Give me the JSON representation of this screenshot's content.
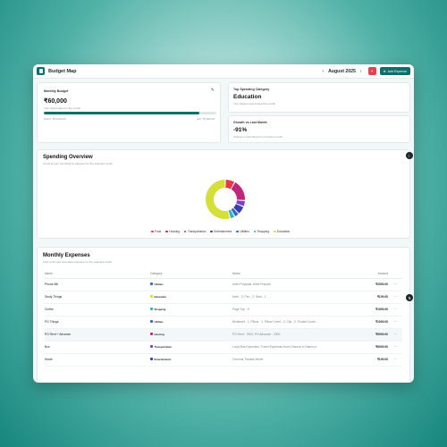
{
  "app": {
    "title": "Budget Map"
  },
  "header": {
    "prev": "‹",
    "month": "August 2025",
    "next": "›",
    "add_label": "Add Expense"
  },
  "budget_card": {
    "label": "Monthly Budget",
    "value": "₹60,000",
    "sub": "Your total budget for the month",
    "progress_fraction": 0.9,
    "spent": "Spent: ₹54,000.00",
    "left": "Left: ₹6,000.00"
  },
  "top_category_card": {
    "label": "Top Spending Category",
    "value": "Education",
    "sub": "Your highest spend area this month"
  },
  "growth_card": {
    "label": "Growth vs Last Month",
    "value": "-91%",
    "sub": "Change in spending from previous month"
  },
  "overview": {
    "title": "Spending Overview",
    "subtitle": "A look at your spending by category for the selected month.",
    "legend": [
      {
        "name": "Food",
        "color": "#e53948"
      },
      {
        "name": "Housing",
        "color": "#c0267a"
      },
      {
        "name": "Transportation",
        "color": "#7a3fc4"
      },
      {
        "name": "Entertainment",
        "color": "#3a3fb0"
      },
      {
        "name": "Utilities",
        "color": "#2f67c2"
      },
      {
        "name": "Shopping",
        "color": "#2fb0c9"
      },
      {
        "name": "Education",
        "color": "#d4df3a"
      }
    ],
    "slices": [
      {
        "name": "Food",
        "value": 8
      },
      {
        "name": "Housing",
        "value": 18
      },
      {
        "name": "Transportation",
        "value": 5
      },
      {
        "name": "Entertainment",
        "value": 7
      },
      {
        "name": "Utilities",
        "value": 4
      },
      {
        "name": "Shopping",
        "value": 4
      },
      {
        "name": "Education",
        "value": 54
      }
    ]
  },
  "expenses": {
    "title": "Monthly Expenses",
    "subtitle": "A list of all your recorded expenses for the selected month.",
    "columns": [
      "Name",
      "Category",
      "Notes",
      "Amount"
    ],
    "rows": [
      {
        "name": "Phone Bill",
        "category": "Utilities",
        "notes": "Airtel Postpaid, Airtel Prepaid",
        "amount": "₹2000.00",
        "color": "#2f67c2"
      },
      {
        "name": "Study Things",
        "category": "Education",
        "notes": "Note - 3, Pen - 2, Note - 1",
        "amount": "₹100.00",
        "color": "#d4df3a"
      },
      {
        "name": "Clothe",
        "category": "Shopping",
        "notes": "Page Top - 5",
        "amount": "₹1000.00",
        "color": "#2fb0c9"
      },
      {
        "name": "PG Things",
        "category": "Utilities",
        "notes": "Bedsheet - 1, Pillow - 1, Pillow Cover - 2, Clip - 2, Pocket Cover...",
        "amount": "₹1000.00",
        "color": "#2f67c2"
      },
      {
        "name": "PG Rent + Advance",
        "category": "Housing",
        "notes": "PG Rent - 7500, PG Advance - 2000",
        "amount": "₹9000.00",
        "color": "#c0267a"
      },
      {
        "name": "Bus",
        "category": "Transportation",
        "notes": "Local Bus Expenses, Travel Expenses from Chennai to Salem p...",
        "amount": "₹6000.00",
        "color": "#7a3fc4"
      },
      {
        "name": "Movie",
        "category": "Entertainment",
        "notes": "Chennai Theatre Movie",
        "amount": "₹100.00",
        "color": "#3a3fb0"
      }
    ]
  }
}
